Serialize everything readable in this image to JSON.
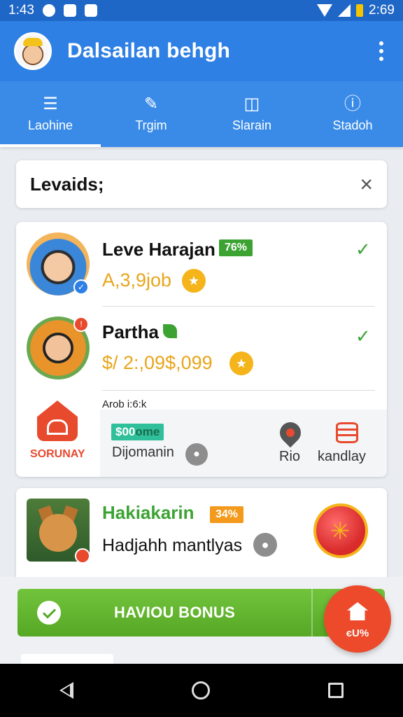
{
  "status_bar": {
    "time_left": "1:43",
    "time_right": "2:69"
  },
  "app_bar": {
    "title": "Dalsailan behgh"
  },
  "tabs": [
    {
      "label": "Laohine",
      "icon": "list-icon",
      "active": true
    },
    {
      "label": "Trgim",
      "icon": "edit-icon",
      "active": false
    },
    {
      "label": "Slarain",
      "icon": "cap-icon",
      "active": false
    },
    {
      "label": "Stadoh",
      "icon": "info-icon",
      "active": false
    }
  ],
  "search": {
    "value": "Levaids;"
  },
  "card1": {
    "row1": {
      "name": "Leve Harajan",
      "tag": "76%",
      "amount": "A,3,9job"
    },
    "row2": {
      "name": "Partha",
      "amount": "$/ 2:,09$,099"
    },
    "small_label": "Arob i:6:k",
    "brand_label": "SORUNAY",
    "pill": {
      "green": "$00",
      "dark": "ome"
    },
    "sub_label": "Dijomanin",
    "pin_label": "Rio",
    "db_label": "kandlay"
  },
  "card2": {
    "name": "Hakiakarin",
    "tag": "34%",
    "sub": "Hadjahh mantlyas"
  },
  "bonus": {
    "label": "HAVIOU BONUS"
  },
  "fab": {
    "label": "єU%"
  },
  "colors": {
    "primary": "#2f80e4",
    "green": "#3ca333",
    "orange": "#f39a1c",
    "gold": "#f4b41a",
    "red": "#e84a2e"
  }
}
